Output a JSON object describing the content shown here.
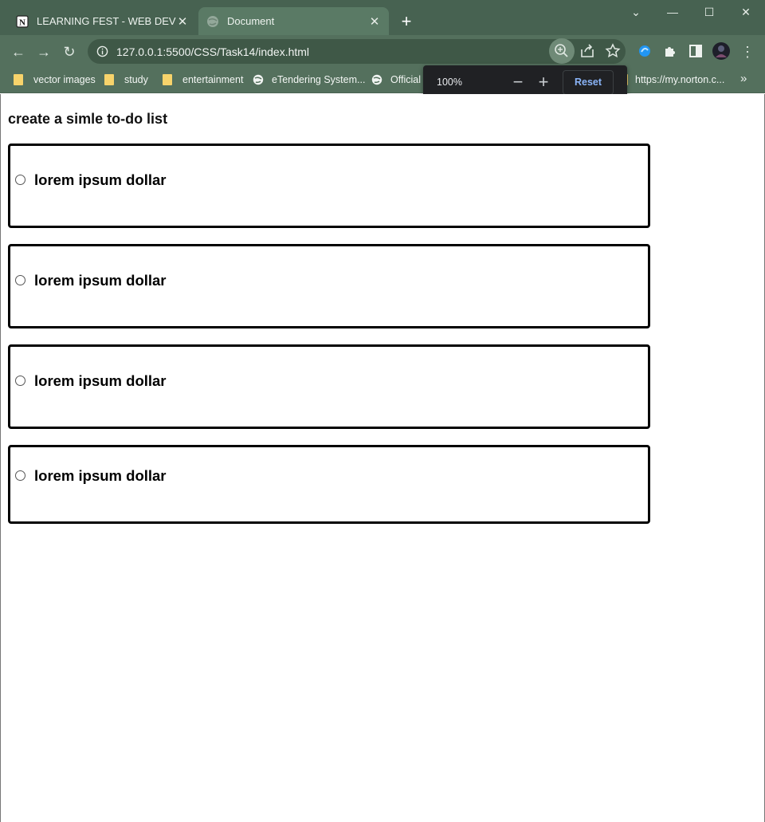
{
  "browser": {
    "tabs": [
      {
        "title": "LEARNING FEST - WEB DEVELOPM"
      },
      {
        "title": "Document"
      }
    ],
    "url": "127.0.0.1:5500/CSS/Task14/index.html",
    "bookmarks": [
      {
        "label": "vector images",
        "icon": "folder-icon"
      },
      {
        "label": "study",
        "icon": "folder-icon"
      },
      {
        "label": "entertainment",
        "icon": "folder-icon"
      },
      {
        "label": "eTendering System...",
        "icon": "globe-icon"
      },
      {
        "label": "Official",
        "icon": "globe-icon"
      },
      {
        "label": "https://my.norton.c...",
        "icon": "folder-icon"
      }
    ],
    "zoom": {
      "level": "100%",
      "reset_label": "Reset"
    }
  },
  "page": {
    "heading": "create a simle to-do list",
    "items": [
      {
        "label": "lorem ipsum dollar"
      },
      {
        "label": "lorem ipsum dollar"
      },
      {
        "label": "lorem ipsum dollar"
      },
      {
        "label": "lorem ipsum dollar"
      }
    ]
  },
  "colors": {
    "tab_strip": "#476251",
    "toolbar": "#54705d",
    "popup": "#202124",
    "reset_text": "#8ab4f8"
  }
}
